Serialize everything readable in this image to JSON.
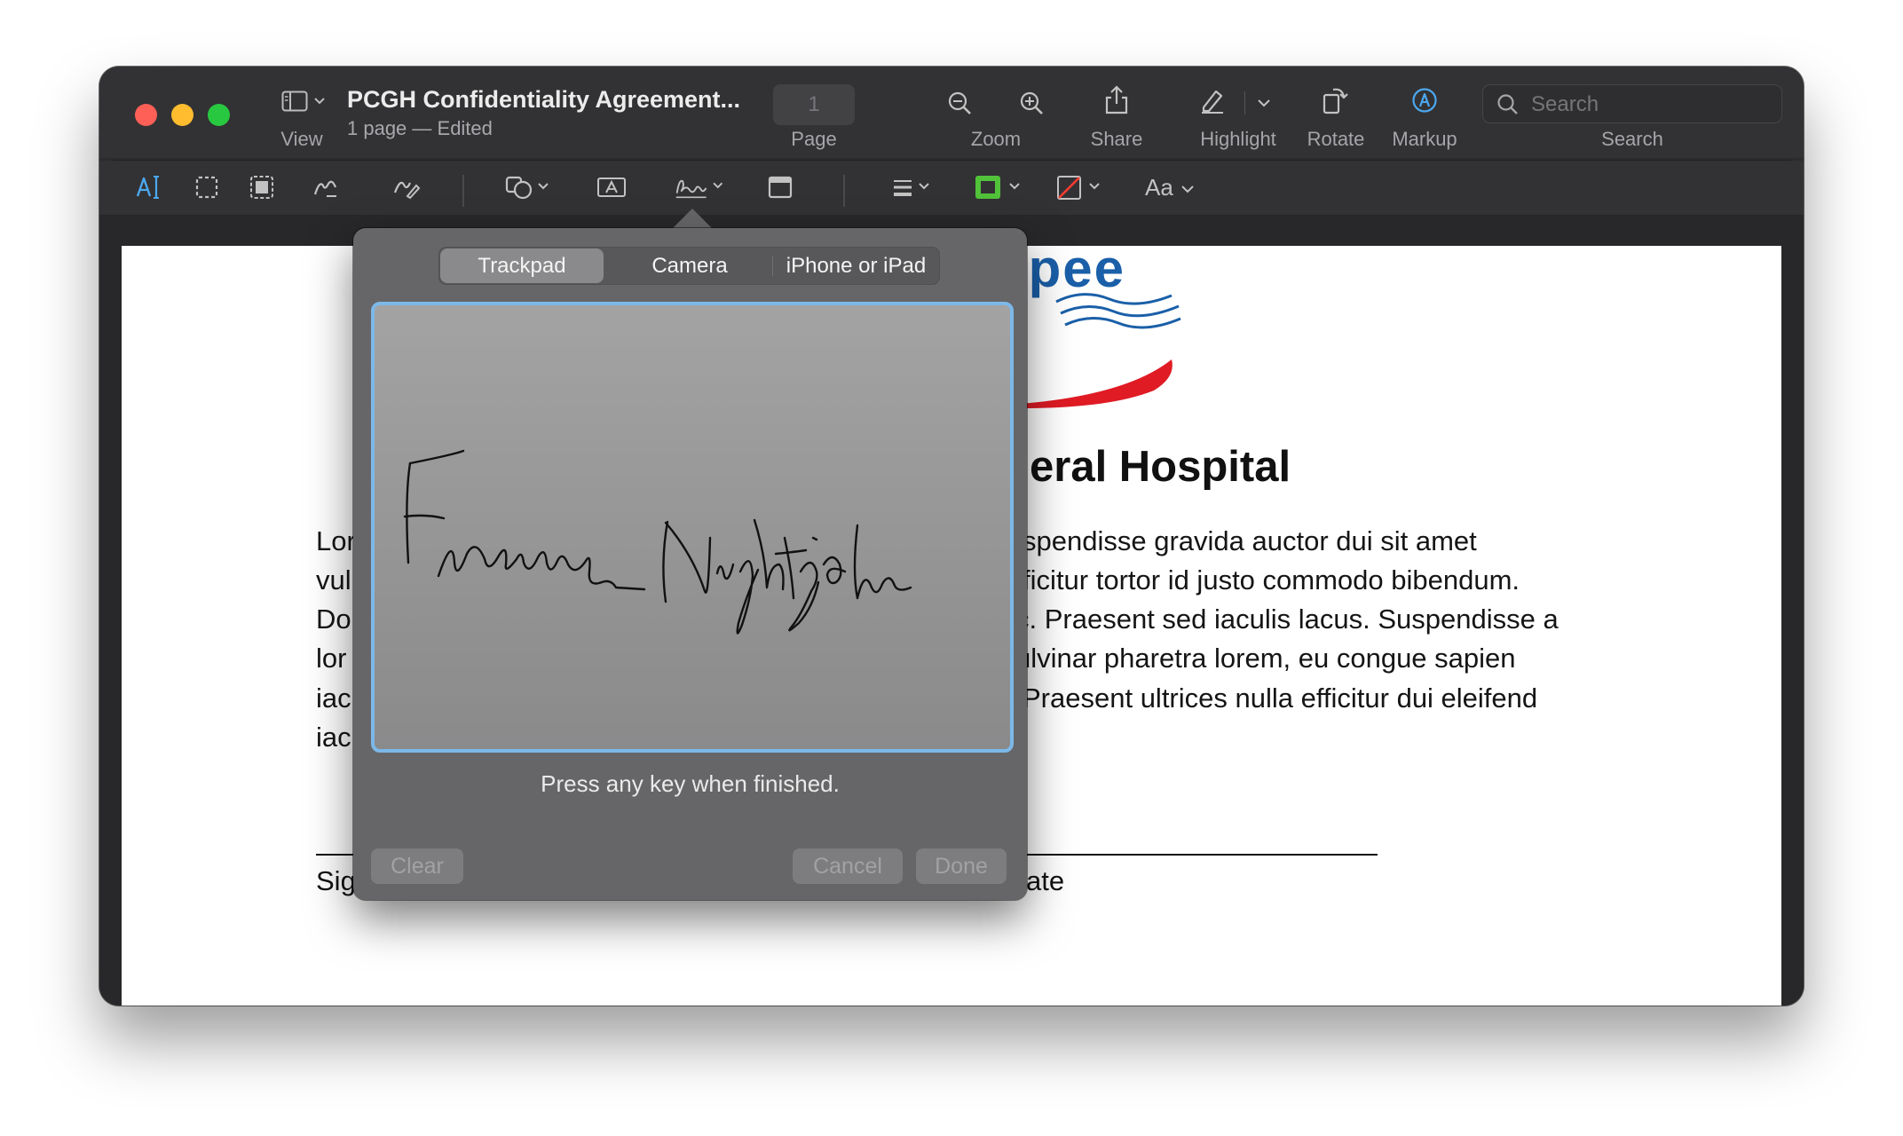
{
  "window": {
    "title": "PCGH Confidentiality Agreement...",
    "subtitle": "1 page — Edited"
  },
  "toolbar": {
    "view_label": "View",
    "page_value": "1",
    "page_label": "Page",
    "zoom_label": "Zoom",
    "share_label": "Share",
    "highlight_label": "Highlight",
    "rotate_label": "Rotate",
    "markup_label": "Markup",
    "search_placeholder": "Search",
    "search_label": "Search"
  },
  "markup_toolbar": {
    "icons": [
      "text-selection-icon",
      "rectangular-selection-icon",
      "smart-lasso-icon",
      "sketch-icon",
      "draw-icon",
      "shapes-icon",
      "text-box-icon",
      "sign-icon",
      "note-icon",
      "shape-style-icon",
      "border-color-icon",
      "fill-color-icon",
      "text-style-icon"
    ],
    "text_style_label": "Aa",
    "accent_color": "#4ca8f0",
    "border_color": "#52c23a",
    "fill_slash_color": "#ff3b30"
  },
  "document": {
    "logo_partial": "upee",
    "heading_partial": "eral Hospital",
    "left_fragments": [
      "Lor",
      "vul",
      "Do",
      "lor",
      "iac",
      "iac"
    ],
    "right_lines": [
      "spendisse gravida auctor dui sit amet",
      "fficitur tortor id justo commodo bibendum.",
      "c. Praesent sed iaculis lacus. Suspendisse a",
      "ulvinar pharetra lorem, eu congue sapien",
      "Praesent ultrices nulla efficitur dui eleifend"
    ],
    "signature_label_partial": "Sig",
    "date_label_partial": "ate"
  },
  "signature_popover": {
    "tabs": [
      "Trackpad",
      "Camera",
      "iPhone or iPad"
    ],
    "active_tab": "Trackpad",
    "hint": "Press any key when finished.",
    "clear_label": "Clear",
    "cancel_label": "Cancel",
    "done_label": "Done",
    "pad_border_color": "#7cb8e8"
  }
}
